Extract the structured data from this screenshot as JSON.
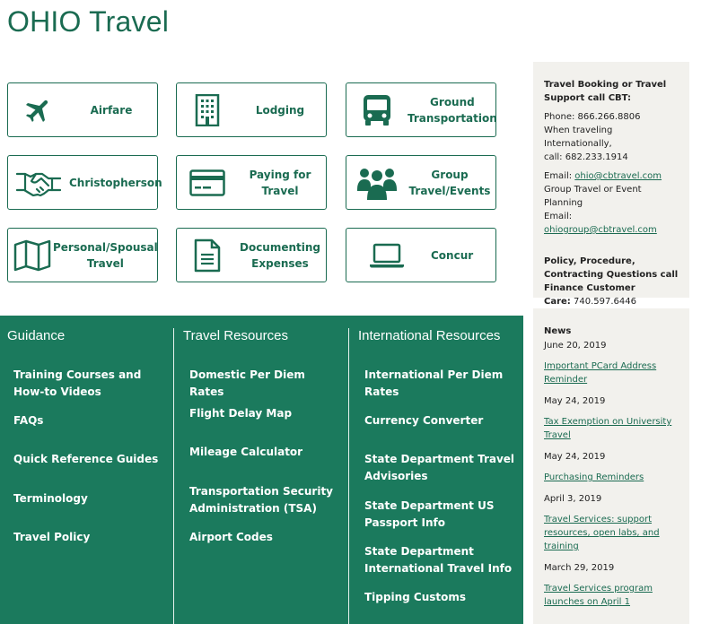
{
  "page": {
    "title": "OHIO Travel"
  },
  "tiles": [
    {
      "label": "Airfare",
      "icon": "airplane-icon"
    },
    {
      "label": "Lodging",
      "icon": "building-icon"
    },
    {
      "label": "Ground\nTransportation",
      "icon": "bus-icon"
    },
    {
      "label": "Christopherson",
      "icon": "handshake-icon"
    },
    {
      "label": "Paying for\nTravel",
      "icon": "credit-card-icon"
    },
    {
      "label": "Group\nTravel/Events",
      "icon": "group-icon"
    },
    {
      "label": "Personal/Spousal\nTravel",
      "icon": "map-icon"
    },
    {
      "label": "Documenting\nExpenses",
      "icon": "document-icon"
    },
    {
      "label": "Concur",
      "icon": "laptop-icon"
    }
  ],
  "cbt": {
    "heading_line1": "Travel Booking or Travel",
    "heading_line2": "Support call CBT:",
    "phone": "Phone: 866.266.8806",
    "intl_line1": "When traveling Internationally,",
    "intl_line2": "call: 682.233.1914",
    "email_label": "Email: ",
    "email": "ohio@cbtravel.com",
    "group_line": "Group Travel or Event Planning",
    "group_email_label": "Email: ",
    "group_email": "ohiogroup@cbtravel.com",
    "policy_line1": "Policy, Procedure,",
    "policy_line2": "Contracting Questions call",
    "policy_line3": "Finance Customer",
    "care_label": "Care:",
    "care_phone": " 740.597.6446"
  },
  "news": {
    "heading": "News",
    "items": [
      {
        "date": "June 20, 2019",
        "title": "Important PCard Address Reminder"
      },
      {
        "date": "May 24, 2019",
        "title": "Tax Exemption on University Travel"
      },
      {
        "date": "May 24, 2019",
        "title": "Purchasing Reminders"
      },
      {
        "date": "April 3, 2019",
        "title": "Travel Services: support resources, open labs, and training"
      },
      {
        "date": "March 29, 2019",
        "title": "Travel Services program launches on April 1"
      }
    ]
  },
  "guidance": {
    "heading": "Guidance",
    "links": [
      "Training Courses and How-to Videos",
      "FAQs",
      "Quick Reference Guides",
      "Terminology",
      "Travel Policy"
    ]
  },
  "travel_resources": {
    "heading": "Travel Resources",
    "links": [
      "Domestic Per Diem Rates",
      "Flight Delay Map",
      "Mileage Calculator",
      "Transportation Security Administration (TSA)",
      "Airport Codes"
    ]
  },
  "international_resources": {
    "heading": "International Resources",
    "links": [
      "International Per Diem Rates",
      "Currency Converter",
      "State Department Travel Advisories",
      "State Department US Passport Info",
      "State Department International Travel Info",
      "Tipping Customs"
    ]
  },
  "colors": {
    "brand_green": "#1a6b51",
    "band_green": "#1b7a5d",
    "card_bg": "#f2f1ed"
  }
}
